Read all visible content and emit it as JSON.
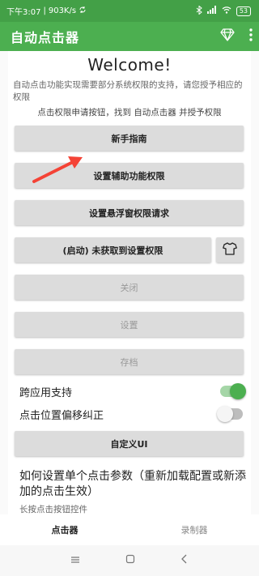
{
  "status_bar": {
    "time": "下午3:07",
    "speed": "903K/s",
    "battery": "53"
  },
  "app_bar": {
    "title": "自动点击器"
  },
  "main": {
    "welcome": "Welcome!",
    "description": "自动点击功能实现需要部分系统权限的支持，请您授予相应的权限",
    "hint": "点击权限申请按钮，找到 自动点击器 并授予权限",
    "buttons": {
      "guide": "新手指南",
      "accessibility": "设置辅助功能权限",
      "overlay": "设置悬浮窗权限请求",
      "start": "(启动) 未获取到设置权限",
      "close": "关闭",
      "settings": "设置",
      "save": "存档",
      "custom_ui": "自定义UI"
    },
    "toggles": {
      "cross_app": {
        "label": "跨应用支持",
        "on": true
      },
      "offset_fix": {
        "label": "点击位置偏移纠正",
        "on": false
      }
    },
    "section_title": "如何设置单个点击参数（重新加载配置或新添加的点击生效）",
    "section_sub": "长按点击按钮控件"
  },
  "bottom_nav": {
    "clicker": "点击器",
    "recorder": "录制器"
  },
  "colors": {
    "primary": "#4caf50",
    "status": "#43a047",
    "arrow": "#f44336"
  }
}
